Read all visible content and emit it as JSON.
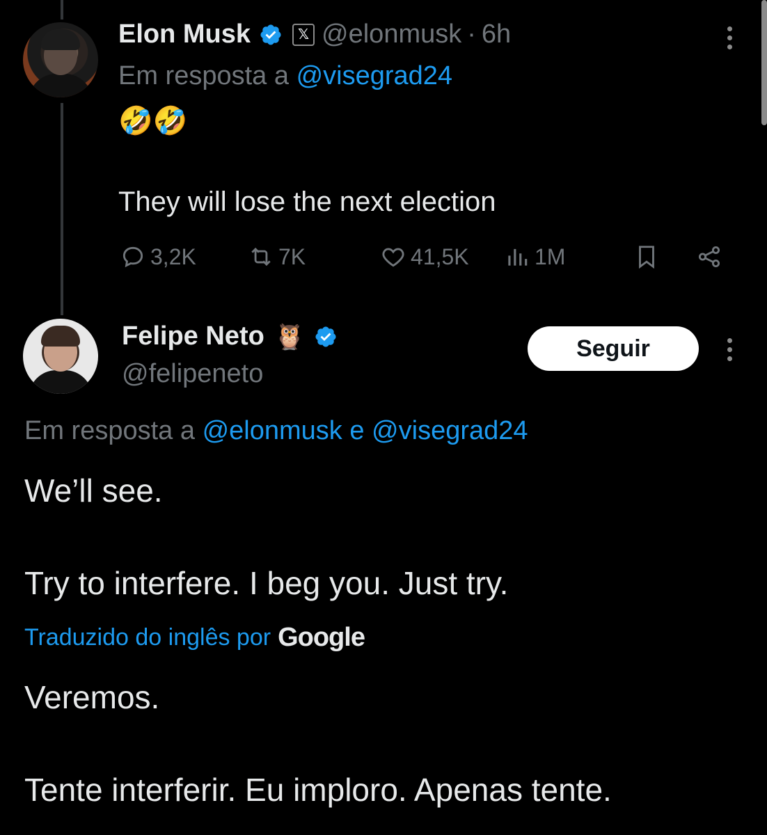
{
  "tweet1": {
    "author_name": "Elon Musk",
    "handle": "@elonmusk",
    "separator": "·",
    "time": "6h",
    "reply_prefix": "Em resposta a",
    "reply_to": "@visegrad24",
    "emoji": "🤣🤣",
    "text": "They will lose the next election",
    "stats": {
      "replies": "3,2K",
      "reposts": "7K",
      "likes": "41,5K",
      "views": "1M"
    }
  },
  "tweet2": {
    "author_name": "Felipe Neto",
    "owl_emoji": "🦉",
    "handle": "@felipeneto",
    "follow_label": "Seguir",
    "reply_prefix": "Em resposta a",
    "reply_to_1": "@elonmusk",
    "reply_conj": "e",
    "reply_to_2": "@visegrad24",
    "line1": "We’ll see.",
    "line2": "Try to interfere. I beg you. Just try.",
    "translated_label": "Traduzido do inglês por",
    "translator": "Google",
    "translated_line1": "Veremos.",
    "translated_line2": "Tente interferir. Eu imploro. Apenas tente."
  },
  "colors": {
    "background": "#000000",
    "text": "#e7e9ea",
    "secondary": "#71767b",
    "link": "#1d9bf0"
  }
}
